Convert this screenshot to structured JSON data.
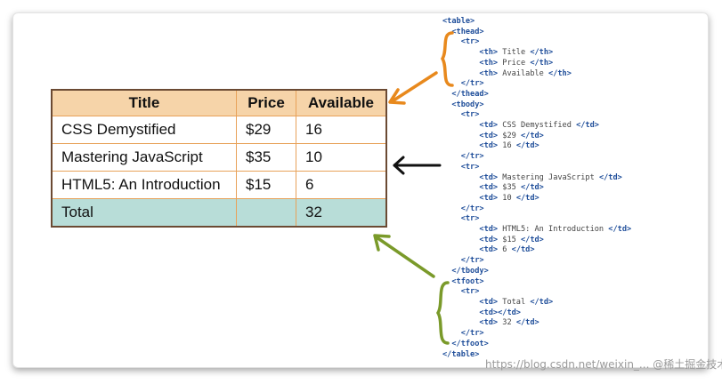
{
  "table": {
    "headers": [
      "Title",
      "Price",
      "Available"
    ],
    "rows": [
      [
        "CSS Demystified",
        "$29",
        "16"
      ],
      [
        "Mastering JavaScript",
        "$35",
        "10"
      ],
      [
        "HTML5: An Introduction",
        "$15",
        "6"
      ]
    ],
    "footer": [
      "Total",
      "",
      "32"
    ]
  },
  "code_lines": [
    {
      "tag": "<table>",
      "text": ""
    },
    {
      "tag": "<thead>",
      "text": ""
    },
    {
      "tag": "<tr>",
      "text": ""
    },
    {
      "tag": "<th>",
      "text": " Title ",
      "close": "</th>"
    },
    {
      "tag": "<th>",
      "text": " Price ",
      "close": "</th>"
    },
    {
      "tag": "<th>",
      "text": " Available ",
      "close": "</th>"
    },
    {
      "tag": "</tr>",
      "text": ""
    },
    {
      "tag": "</thead>",
      "text": ""
    },
    {
      "tag": "<tbody>",
      "text": ""
    },
    {
      "tag": "<tr>",
      "text": ""
    },
    {
      "tag": "<td>",
      "text": " CSS Demystified ",
      "close": "</td>"
    },
    {
      "tag": "<td>",
      "text": " $29 ",
      "close": "</td>"
    },
    {
      "tag": "<td>",
      "text": " 16 ",
      "close": "</td>"
    },
    {
      "tag": "</tr>",
      "text": ""
    },
    {
      "tag": "<tr>",
      "text": ""
    },
    {
      "tag": "<td>",
      "text": " Mastering JavaScript ",
      "close": "</td>"
    },
    {
      "tag": "<td>",
      "text": " $35 ",
      "close": "</td>"
    },
    {
      "tag": "<td>",
      "text": " 10 ",
      "close": "</td>"
    },
    {
      "tag": "</tr>",
      "text": ""
    },
    {
      "tag": "<tr>",
      "text": ""
    },
    {
      "tag": "<td>",
      "text": " HTML5: An Introduction ",
      "close": "</td>"
    },
    {
      "tag": "<td>",
      "text": " $15 ",
      "close": "</td>"
    },
    {
      "tag": "<td>",
      "text": " 6 ",
      "close": "</td>"
    },
    {
      "tag": "</tr>",
      "text": ""
    },
    {
      "tag": "</tbody>",
      "text": ""
    },
    {
      "tag": "<tfoot>",
      "text": ""
    },
    {
      "tag": "<tr>",
      "text": ""
    },
    {
      "tag": "<td>",
      "text": " Total ",
      "close": "</td>"
    },
    {
      "tag": "<td>",
      "text": "",
      "close": "</td>"
    },
    {
      "tag": "<td>",
      "text": " 32 ",
      "close": "</td>"
    },
    {
      "tag": "</tr>",
      "text": ""
    },
    {
      "tag": "</tfoot>",
      "text": ""
    },
    {
      "tag": "</table>",
      "text": ""
    }
  ],
  "watermark": "https://blog.csdn.net/weixin_... @稀土掘金技术社区",
  "colors": {
    "header_bg": "#f6d4a9",
    "footer_bg": "#b8ddd8",
    "cell_border": "#e8a25a",
    "table_border": "#6b4a33",
    "arrow_orange": "#e8891d",
    "arrow_black": "#111111",
    "arrow_green": "#7a9a2a",
    "code_tag": "#1f4e9a"
  }
}
